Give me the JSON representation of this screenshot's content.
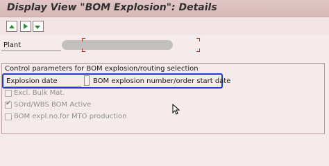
{
  "window": {
    "title": "Display View \"BOM Explosion\": Details"
  },
  "toolbar": {
    "buttons": [
      {
        "icon": "create-icon"
      },
      {
        "icon": "next-icon"
      },
      {
        "icon": "export-icon"
      }
    ]
  },
  "plant": {
    "label": "Plant",
    "value_redacted": true
  },
  "control_group": {
    "title": "Control parameters for BOM explosion/routing selection",
    "explosion_date": {
      "label": "Explosion date",
      "value": "",
      "hint": "BOM explosion number/order start date"
    },
    "checkboxes": [
      {
        "label": "Excl. Bulk Mat.",
        "checked": false
      },
      {
        "label": "SOrd/WBS BOM Active",
        "checked": true
      },
      {
        "label": "BOM expl.no.for MTO production",
        "checked": false
      }
    ]
  },
  "colors": {
    "background": "#f5ebeb",
    "highlight": "#1a3fd0",
    "required_marker": "#d03030",
    "disabled_text": "#8f8f8f"
  }
}
